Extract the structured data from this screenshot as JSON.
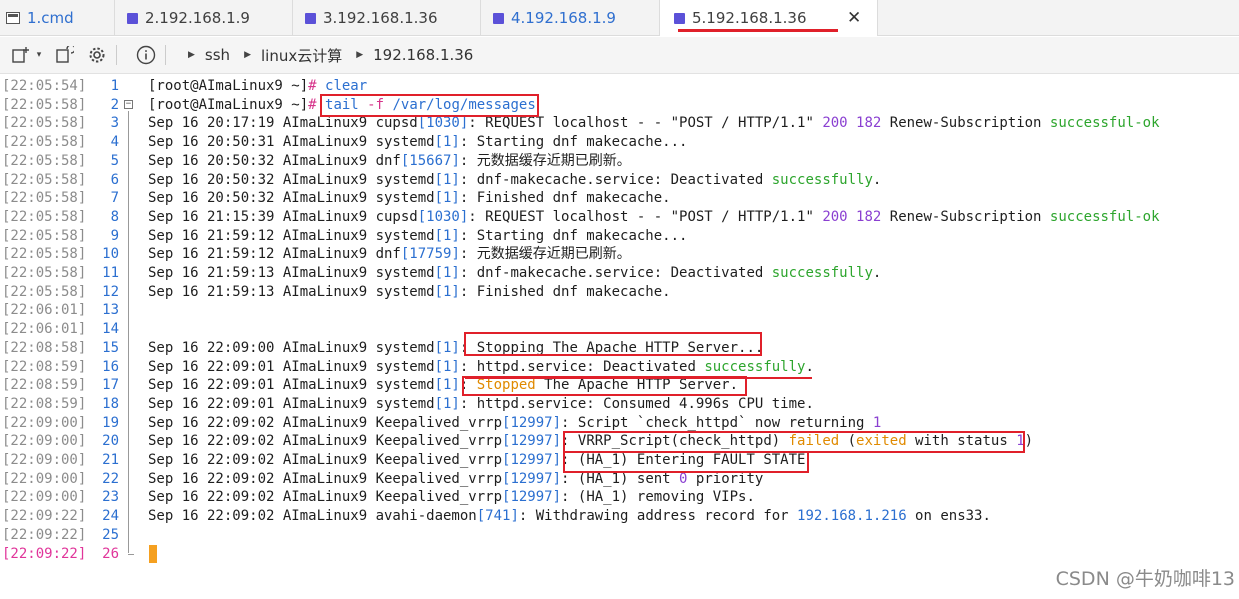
{
  "tabs": [
    {
      "label": "1.cmd"
    },
    {
      "label": "2.192.168.1.9"
    },
    {
      "label": "3.192.168.1.36"
    },
    {
      "label": "4.192.168.1.9"
    },
    {
      "label": "5.192.168.1.36",
      "close": "✕"
    }
  ],
  "toolbar": {
    "breadcrumb": [
      "ssh",
      "linux云计算",
      "192.168.1.36"
    ]
  },
  "terminal": {
    "lines": [
      {
        "ts": "[22:05:54]",
        "n": "1",
        "parts": [
          [
            "[root@AImaLinux9 ~]",
            "prompt"
          ],
          [
            "# ",
            "pink"
          ],
          [
            "clear",
            "blue"
          ]
        ]
      },
      {
        "ts": "[22:05:58]",
        "n": "2",
        "parts": [
          [
            "[root@AImaLinux9 ~]",
            "prompt"
          ],
          [
            "# ",
            "pink"
          ],
          [
            "tail ",
            "blue"
          ],
          [
            "-f",
            "pink"
          ],
          [
            " /var/log/messages",
            "blue"
          ]
        ]
      },
      {
        "ts": "[22:05:58]",
        "n": "3",
        "parts": [
          [
            "Sep 16 20:17:19 AImaLinux9 cupsd",
            ""
          ],
          [
            "[1030]",
            "blue"
          ],
          [
            ": REQUEST localhost - - \"POST / HTTP/1.1\" ",
            ""
          ],
          [
            "200",
            "purple"
          ],
          [
            " ",
            ""
          ],
          [
            "182",
            "purple"
          ],
          [
            " Renew-Subscription ",
            ""
          ],
          [
            "successful-ok",
            "green"
          ]
        ]
      },
      {
        "ts": "[22:05:58]",
        "n": "4",
        "parts": [
          [
            "Sep 16 20:50:31 AImaLinux9 systemd",
            ""
          ],
          [
            "[1]",
            "blue"
          ],
          [
            ": Starting dnf makecache...",
            ""
          ]
        ]
      },
      {
        "ts": "[22:05:58]",
        "n": "5",
        "parts": [
          [
            "Sep 16 20:50:32 AImaLinux9 dnf",
            ""
          ],
          [
            "[15667]",
            "blue"
          ],
          [
            ": 元数据缓存近期已刷新。",
            ""
          ]
        ]
      },
      {
        "ts": "[22:05:58]",
        "n": "6",
        "parts": [
          [
            "Sep 16 20:50:32 AImaLinux9 systemd",
            ""
          ],
          [
            "[1]",
            "blue"
          ],
          [
            ": dnf-makecache.service: Deactivated ",
            ""
          ],
          [
            "successfully",
            "green"
          ],
          [
            ".",
            ""
          ]
        ]
      },
      {
        "ts": "[22:05:58]",
        "n": "7",
        "parts": [
          [
            "Sep 16 20:50:32 AImaLinux9 systemd",
            ""
          ],
          [
            "[1]",
            "blue"
          ],
          [
            ": Finished dnf makecache.",
            ""
          ]
        ]
      },
      {
        "ts": "[22:05:58]",
        "n": "8",
        "parts": [
          [
            "Sep 16 21:15:39 AImaLinux9 cupsd",
            ""
          ],
          [
            "[1030]",
            "blue"
          ],
          [
            ": REQUEST localhost - - \"POST / HTTP/1.1\" ",
            ""
          ],
          [
            "200",
            "purple"
          ],
          [
            " ",
            ""
          ],
          [
            "182",
            "purple"
          ],
          [
            " Renew-Subscription ",
            ""
          ],
          [
            "successful-ok",
            "green"
          ]
        ]
      },
      {
        "ts": "[22:05:58]",
        "n": "9",
        "parts": [
          [
            "Sep 16 21:59:12 AImaLinux9 systemd",
            ""
          ],
          [
            "[1]",
            "blue"
          ],
          [
            ": Starting dnf makecache...",
            ""
          ]
        ]
      },
      {
        "ts": "[22:05:58]",
        "n": "10",
        "parts": [
          [
            "Sep 16 21:59:12 AImaLinux9 dnf",
            ""
          ],
          [
            "[17759]",
            "blue"
          ],
          [
            ": 元数据缓存近期已刷新。",
            ""
          ]
        ]
      },
      {
        "ts": "[22:05:58]",
        "n": "11",
        "parts": [
          [
            "Sep 16 21:59:13 AImaLinux9 systemd",
            ""
          ],
          [
            "[1]",
            "blue"
          ],
          [
            ": dnf-makecache.service: Deactivated ",
            ""
          ],
          [
            "successfully",
            "green"
          ],
          [
            ".",
            ""
          ]
        ]
      },
      {
        "ts": "[22:05:58]",
        "n": "12",
        "parts": [
          [
            "Sep 16 21:59:13 AImaLinux9 systemd",
            ""
          ],
          [
            "[1]",
            "blue"
          ],
          [
            ": Finished dnf makecache.",
            ""
          ]
        ]
      },
      {
        "ts": "[22:06:01]",
        "n": "13",
        "parts": []
      },
      {
        "ts": "[22:06:01]",
        "n": "14",
        "parts": []
      },
      {
        "ts": "[22:08:58]",
        "n": "15",
        "parts": [
          [
            "Sep 16 22:09:00 AImaLinux9 systemd",
            ""
          ],
          [
            "[1]",
            "blue"
          ],
          [
            ": Stopping The Apache HTTP Server...",
            ""
          ]
        ]
      },
      {
        "ts": "[22:08:59]",
        "n": "16",
        "parts": [
          [
            "Sep 16 22:09:01 AImaLinux9 systemd",
            ""
          ],
          [
            "[1]",
            "blue"
          ],
          [
            ": httpd.service: Deactivated ",
            ""
          ],
          [
            "successfully",
            "green"
          ],
          [
            ".",
            ""
          ]
        ]
      },
      {
        "ts": "[22:08:59]",
        "n": "17",
        "parts": [
          [
            "Sep 16 22:09:01 AImaLinux9 systemd",
            ""
          ],
          [
            "[1]",
            "blue"
          ],
          [
            ": ",
            ""
          ],
          [
            "Stopped",
            "orange"
          ],
          [
            " The Apache HTTP Server.",
            ""
          ]
        ]
      },
      {
        "ts": "[22:08:59]",
        "n": "18",
        "parts": [
          [
            "Sep 16 22:09:01 AImaLinux9 systemd",
            ""
          ],
          [
            "[1]",
            "blue"
          ],
          [
            ": httpd.service: Consumed 4.996s CPU time.",
            ""
          ]
        ]
      },
      {
        "ts": "[22:09:00]",
        "n": "19",
        "parts": [
          [
            "Sep 16 22:09:02 AImaLinux9 Keepalived_vrrp",
            ""
          ],
          [
            "[12997]",
            "blue"
          ],
          [
            ": Script `check_httpd` now returning ",
            ""
          ],
          [
            "1",
            "purple"
          ]
        ]
      },
      {
        "ts": "[22:09:00]",
        "n": "20",
        "parts": [
          [
            "Sep 16 22:09:02 AImaLinux9 Keepalived_vrrp",
            ""
          ],
          [
            "[12997]",
            "blue"
          ],
          [
            ": VRRP_Script(check_httpd) ",
            ""
          ],
          [
            "failed",
            "orange"
          ],
          [
            " (",
            ""
          ],
          [
            "exited",
            "orange"
          ],
          [
            " with status ",
            ""
          ],
          [
            "1",
            "purple"
          ],
          [
            ")",
            ""
          ]
        ]
      },
      {
        "ts": "[22:09:00]",
        "n": "21",
        "parts": [
          [
            "Sep 16 22:09:02 AImaLinux9 Keepalived_vrrp",
            ""
          ],
          [
            "[12997]",
            "blue"
          ],
          [
            ": (HA_1) Entering FAULT STATE",
            ""
          ]
        ]
      },
      {
        "ts": "[22:09:00]",
        "n": "22",
        "parts": [
          [
            "Sep 16 22:09:02 AImaLinux9 Keepalived_vrrp",
            ""
          ],
          [
            "[12997]",
            "blue"
          ],
          [
            ": (HA_1) sent ",
            ""
          ],
          [
            "0",
            "purple"
          ],
          [
            " priority",
            ""
          ]
        ]
      },
      {
        "ts": "[22:09:00]",
        "n": "23",
        "parts": [
          [
            "Sep 16 22:09:02 AImaLinux9 Keepalived_vrrp",
            ""
          ],
          [
            "[12997]",
            "blue"
          ],
          [
            ": (HA_1) removing VIPs.",
            ""
          ]
        ]
      },
      {
        "ts": "[22:09:22]",
        "n": "24",
        "parts": [
          [
            "Sep 16 22:09:02 AImaLinux9 avahi-daemon",
            ""
          ],
          [
            "[741]",
            "blue"
          ],
          [
            ": Withdrawing address record for ",
            ""
          ],
          [
            "192.168.1.216",
            "blue"
          ],
          [
            " on ens33.",
            ""
          ]
        ]
      },
      {
        "ts": "[22:09:22]",
        "n": "25",
        "parts": []
      },
      {
        "ts": "[22:09:22]",
        "n": "26",
        "parts": []
      }
    ]
  },
  "watermark": "CSDN @牛奶咖啡13",
  "colors": {
    "accent_underline": "#e0202a",
    "tab_icon": "#5b51d8",
    "cursor": "#f5a020"
  }
}
